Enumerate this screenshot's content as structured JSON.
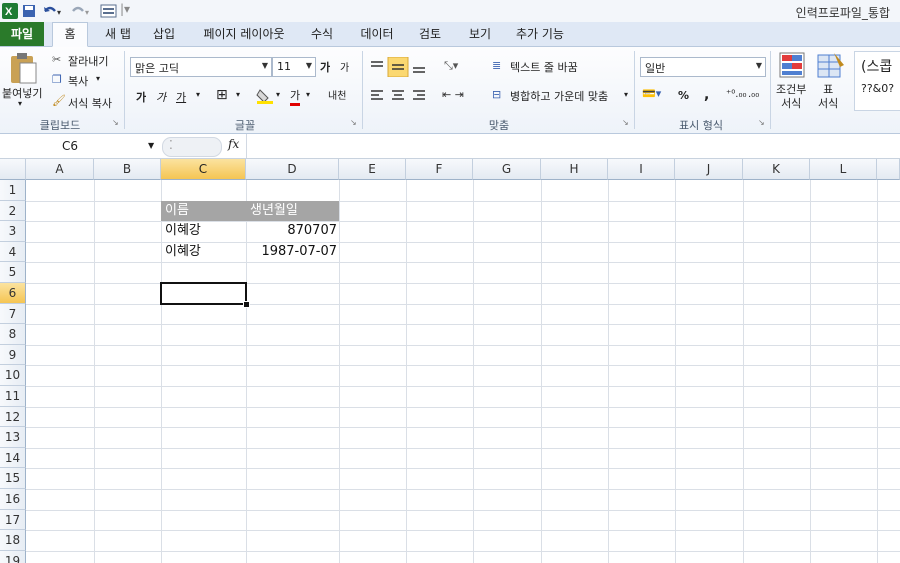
{
  "window": {
    "title": "인력프로파일_통합"
  },
  "tabs": [
    {
      "label": "파일"
    },
    {
      "label": "홈"
    },
    {
      "label": "새 탭"
    },
    {
      "label": "삽입"
    },
    {
      "label": "페이지 레이아웃"
    },
    {
      "label": "수식"
    },
    {
      "label": "데이터"
    },
    {
      "label": "검토"
    },
    {
      "label": "보기"
    },
    {
      "label": "추가 기능"
    }
  ],
  "ribbon": {
    "clipboard": {
      "paste": "붙여넣기",
      "cut": "잘라내기",
      "copy": "복사",
      "format_painter": "서식 복사",
      "group": "클립보드"
    },
    "font": {
      "name": "맑은 고딕",
      "size": "11",
      "group": "글꼴",
      "bold": "가",
      "italic": "가",
      "underline": "가",
      "grow": "가",
      "shrink": "가",
      "color_letter": "가",
      "phonetic": "내천"
    },
    "alignment": {
      "wrap": "텍스트 줄 바꿈",
      "merge": "병합하고 가운데 맞춤",
      "group": "맞춤"
    },
    "number": {
      "format": "일반",
      "percent": "%",
      "comma": ",",
      "inc": ".00 →.0",
      "group": "표시 형식"
    },
    "styles": {
      "conditional": "조건부\n서식",
      "table": "표\n서식",
      "cell_style_preview": "(스콥",
      "cell_style_preview2": "??&0?"
    }
  },
  "formula_bar": {
    "name_box": "C6",
    "fx": "fx",
    "formula": ""
  },
  "sheet": {
    "columns": [
      "A",
      "B",
      "C",
      "D",
      "E",
      "F",
      "G",
      "H",
      "I",
      "J",
      "K",
      "L"
    ],
    "rows": [
      "1",
      "2",
      "3",
      "4",
      "5",
      "6",
      "7",
      "8",
      "9",
      "10",
      "11",
      "12",
      "13",
      "14",
      "15",
      "16",
      "17",
      "18",
      "19"
    ],
    "cells": {
      "C2": "이름",
      "D2": "생년월일",
      "C3": "이혜강",
      "D3": "870707",
      "C4": "이혜강",
      "D4": "1987-07-07"
    },
    "active_cell": "C6"
  }
}
